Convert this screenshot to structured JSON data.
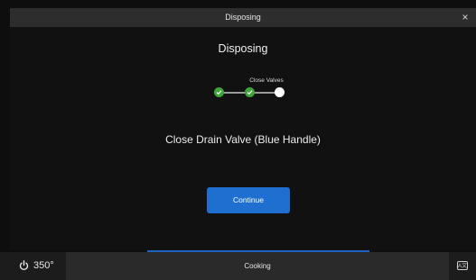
{
  "modal": {
    "title": "Disposing",
    "close_glyph": "×",
    "heading": "Disposing",
    "stepper": {
      "steps_total": 3,
      "completed": 2,
      "current_label": "Close Valves"
    },
    "instruction": "Close Drain Valve (Blue Handle)",
    "continue_label": "Continue"
  },
  "bottom_bar": {
    "temperature": "350°",
    "status": "Cooking",
    "right_icon": "language-icon"
  },
  "colors": {
    "accent": "#1f6fd1",
    "step_done": "#3fa53a",
    "step_current": "#ffffff"
  }
}
